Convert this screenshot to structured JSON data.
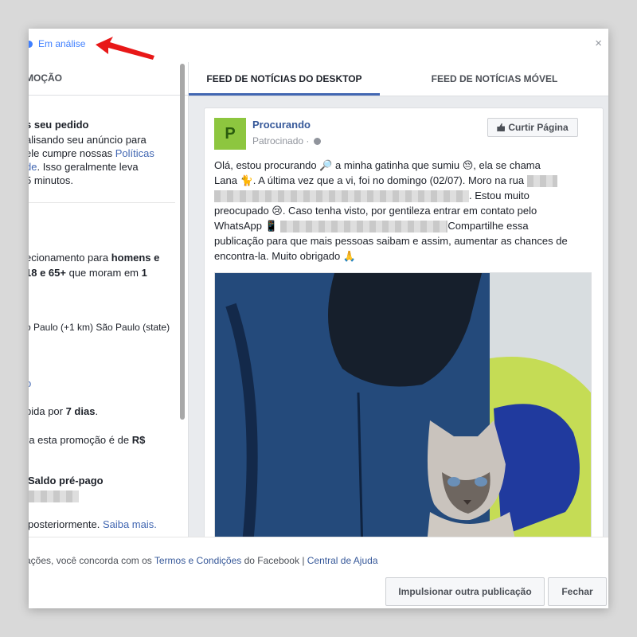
{
  "status": {
    "label": "Em análise",
    "close": "×"
  },
  "left": {
    "tab_label": "MOÇÃO",
    "section1": {
      "title": "s seu pedido",
      "line1": "alisando seu anúncio para",
      "line2_prefix": "ele cumpre nossas ",
      "line2_link": "Políticas",
      "line3_link": "de",
      "line3_suffix": ". Isso geralmente leva",
      "line4": "5 minutos."
    },
    "audience": {
      "line1_prefix": "ecionamento para ",
      "line1_bold": "homens e",
      "line2_bold": " 18 e 65+",
      "line2_mid": " que moram em ",
      "line2_bold2": "1"
    },
    "location": "o Paulo (+1 km) São Paulo (state)",
    "link_o": "o",
    "duration_prefix": "bida por ",
    "duration_bold": "7 dias",
    "duration_suffix": ".",
    "budget_prefix": "ra esta promoção é de ",
    "budget_bold": "R$",
    "payment_title": "Saldo pré-pago",
    "later_text": "posteriormente. ",
    "later_link": "Saiba mais."
  },
  "tabs": [
    "FEED DE NOTÍCIAS DO DESKTOP",
    "FEED DE NOTÍCIAS MÓVEL"
  ],
  "post": {
    "avatar_letter": "P",
    "page_name": "Procurando",
    "sponsored": "Patrocinado · ",
    "like_button": "Curtir Página",
    "line1": "Olá, estou procurando 🔎 a minha gatinha que sumiu 😔, ela se chama",
    "line2": "Lana 🐈. A última vez que a vi, foi no domingo (02/07). Moro na rua",
    "line3": ". Estou muito",
    "line4": "preocupado 😢. Caso tenha visto, por gentileza entrar em contato pelo",
    "line5_prefix": "WhatsApp 📱",
    "line5_suffix": "Compartilhe essa",
    "line6": "publicação para que mais pessoas saibam e assim, aumentar as chances de",
    "line7": "encontra-la. Muito obrigado 🙏"
  },
  "footer": {
    "legal_prefix": "ações, você concorda com os ",
    "terms_link": "Termos e Condições",
    "legal_mid": " do Facebook  |  ",
    "help_link": "Central de Ajuda",
    "boost_button": "Impulsionar outra publicação",
    "close_button": "Fechar"
  },
  "colors": {
    "accent": "#4267b2",
    "status": "#4080ff",
    "arrow": "#e81818",
    "avatar": "#8dc63f"
  }
}
